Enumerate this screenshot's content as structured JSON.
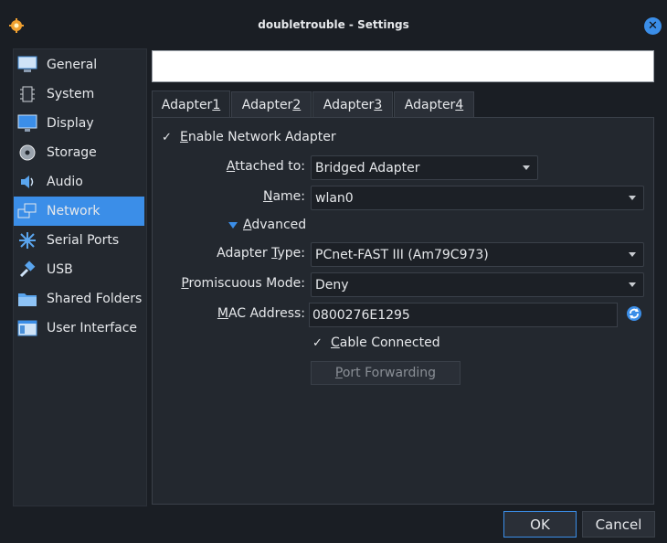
{
  "window": {
    "title": "doubletrouble - Settings"
  },
  "sidebar": {
    "items": [
      {
        "label": "General",
        "icon": "monitor-icon"
      },
      {
        "label": "System",
        "icon": "chip-icon"
      },
      {
        "label": "Display",
        "icon": "display-icon"
      },
      {
        "label": "Storage",
        "icon": "disk-icon"
      },
      {
        "label": "Audio",
        "icon": "speaker-icon"
      },
      {
        "label": "Network",
        "icon": "network-icon"
      },
      {
        "label": "Serial Ports",
        "icon": "serial-port-icon"
      },
      {
        "label": "USB",
        "icon": "usb-icon"
      },
      {
        "label": "Shared Folders",
        "icon": "folder-icon"
      },
      {
        "label": "User Interface",
        "icon": "window-icon"
      }
    ],
    "selected": "Network"
  },
  "search": {
    "value": ""
  },
  "tabs": [
    {
      "pre": "Adapter ",
      "key": "1"
    },
    {
      "pre": "Adapter ",
      "key": "2"
    },
    {
      "pre": "Adapter ",
      "key": "3"
    },
    {
      "pre": "Adapter ",
      "key": "4"
    }
  ],
  "network": {
    "enable_pre": "",
    "enable_key": "E",
    "enable_rest": "nable Network Adapter",
    "attached": {
      "key": "A",
      "rest": "ttached to:",
      "value": "Bridged Adapter"
    },
    "name": {
      "key": "N",
      "rest": "ame:",
      "value": "wlan0"
    },
    "advanced": {
      "key": "A",
      "rest": "dvanced"
    },
    "adapter_type": {
      "pre": "Adapter ",
      "key": "T",
      "rest": "ype:",
      "value": "PCnet-FAST III (Am79C973)"
    },
    "promiscuous": {
      "key": "P",
      "rest": "romiscuous Mode:",
      "value": "Deny"
    },
    "mac": {
      "key": "M",
      "rest": "AC Address:",
      "value": "0800276E1295"
    },
    "cable": {
      "key": "C",
      "rest": "able Connected"
    },
    "port_forwarding": {
      "key": "P",
      "rest": "ort Forwarding"
    }
  },
  "buttons": {
    "ok": "OK",
    "cancel": "Cancel"
  }
}
